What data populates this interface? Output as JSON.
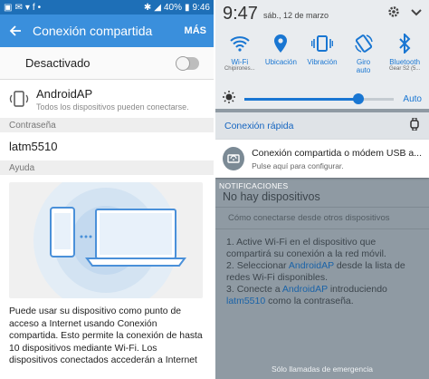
{
  "left": {
    "status_bar": {
      "battery": "40%",
      "time": "9:46"
    },
    "app_bar": {
      "title": "Conexión compartida",
      "more": "MÁS"
    },
    "toggle": {
      "label": "Desactivado"
    },
    "ap": {
      "name": "AndroidAP",
      "subtitle": "Todos los dispositivos pueden conectarse."
    },
    "password": {
      "header": "Contraseña",
      "value": "latm5510"
    },
    "help": {
      "header": "Ayuda",
      "text": "Puede usar su dispositivo como punto de acceso a Internet usando Conexión compartida. Esto permite la conexión de hasta 10 dispositivos mediante Wi-Fi. Los dispositivos conectados accederán a Internet"
    }
  },
  "right": {
    "time": "9:47",
    "date": "sáb., 12 de marzo",
    "tiles": [
      {
        "label": "Wi-Fi",
        "sub": "Chipirones...",
        "icon": "wifi-icon"
      },
      {
        "label": "Ubicación",
        "sub": "",
        "icon": "location-icon"
      },
      {
        "label": "Vibración",
        "sub": "",
        "icon": "vibration-icon"
      },
      {
        "label": "Giro",
        "sub": "auto",
        "icon": "rotation-icon"
      },
      {
        "label": "Bluetooth",
        "sub": "Gear S2 (5...",
        "icon": "bluetooth-icon"
      }
    ],
    "brightness": {
      "level": 0.76,
      "auto_label": "Auto"
    },
    "quick_connect": "Conexión rápida",
    "notification": {
      "title": "Conexión compartida o módem USB a...",
      "subtitle": "Pulse aquí para configurar."
    },
    "notifications_header": "NOTIFICACIONES",
    "no_devices": "No hay dispositivos",
    "connect_header": "Cómo conectarse desde otros dispositivos",
    "steps": [
      {
        "num": "1.",
        "parts": [
          "Active Wi-Fi en el dispositivo que compartirá su conexión a la red móvil."
        ]
      },
      {
        "num": "2.",
        "pre": "Seleccionar ",
        "hl": "AndroidAP",
        "post": " desde la lista de redes Wi-Fi disponibles."
      },
      {
        "num": "3.",
        "pre": "Conecte a ",
        "hl": "AndroidAP",
        "post": " introduciendo ",
        "hl2": "latm5510",
        "post2": " como la contraseña."
      }
    ],
    "emergency": "Sólo llamadas de emergencia"
  },
  "colors": {
    "accent": "#3a8fdc",
    "status_bar": "#1e6fb7",
    "tile_blue": "#1976d2"
  }
}
